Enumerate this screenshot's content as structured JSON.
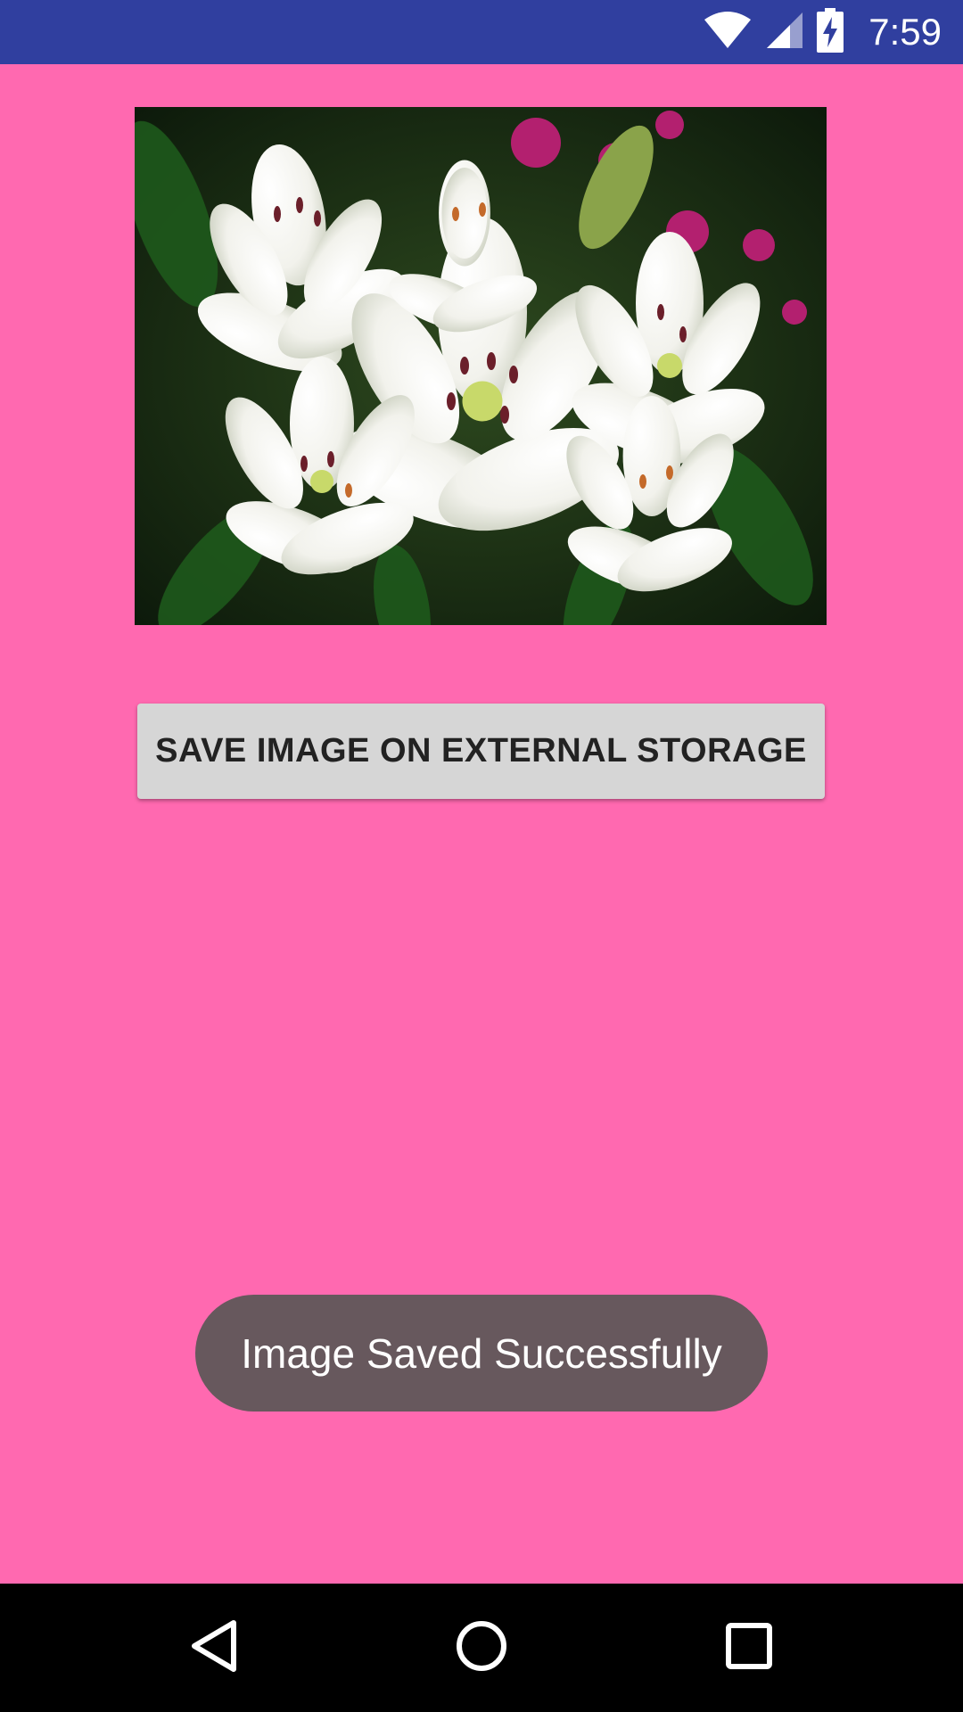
{
  "status_bar": {
    "time": "7:59",
    "icons": [
      "wifi-icon",
      "cell-signal-icon",
      "battery-charging-icon"
    ],
    "color": "#303f9f"
  },
  "main": {
    "background_color": "#ff69b0",
    "image": {
      "subject": "white lilies"
    },
    "save_button_label": "SAVE IMAGE ON EXTERNAL STORAGE"
  },
  "toast": {
    "message": "Image Saved Successfully"
  },
  "nav_bar": {
    "buttons": [
      "back-icon",
      "home-icon",
      "recents-icon"
    ]
  }
}
